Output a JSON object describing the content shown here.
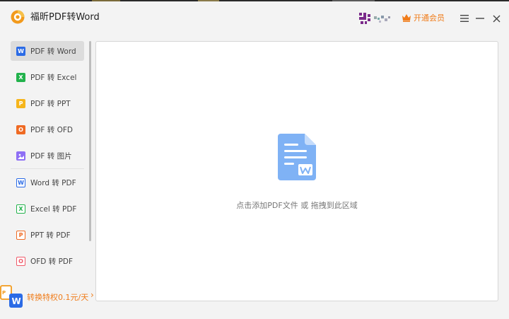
{
  "app": {
    "title": "福昕PDF转Word",
    "vip_label": "开通会员"
  },
  "sidebar": {
    "items": [
      {
        "label": "PDF 转 Word",
        "icon": "word-icon",
        "letter": "W",
        "color": "#2b6be6"
      },
      {
        "label": "PDF 转 Excel",
        "icon": "excel-icon",
        "letter": "X",
        "color": "#22b24c"
      },
      {
        "label": "PDF 转 PPT",
        "icon": "ppt-icon",
        "letter": "P",
        "color": "#f6b51c"
      },
      {
        "label": "PDF 转 OFD",
        "icon": "ofd-icon",
        "letter": "O",
        "color": "#ef6a23"
      },
      {
        "label": "PDF 转 图片",
        "icon": "image-icon",
        "letter": "",
        "color": "#8e6ff5"
      },
      {
        "label": "Word 转 PDF",
        "icon": "word-outline-icon",
        "letter": "W",
        "color": "#2b6be6"
      },
      {
        "label": "Excel 转 PDF",
        "icon": "excel-outline-icon",
        "letter": "X",
        "color": "#22b24c"
      },
      {
        "label": "PPT 转 PDF",
        "icon": "ppt-outline-icon",
        "letter": "P",
        "color": "#ef6a23"
      },
      {
        "label": "OFD 转 PDF",
        "icon": "ofd-outline-icon",
        "letter": "O",
        "color": "#ef5a6a"
      }
    ],
    "active_index": 0,
    "promo": "转换特权0.1元/天"
  },
  "main": {
    "drop_hint": "点击添加PDF文件 或 拖拽到此区域"
  },
  "colors": {
    "accent": "#f07c1a",
    "doc_icon": "#7fb2f5"
  }
}
